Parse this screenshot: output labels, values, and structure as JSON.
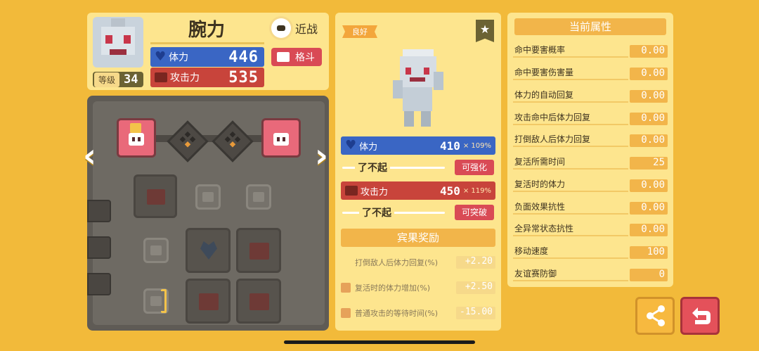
{
  "header": {
    "pokemon_name": "腕力",
    "level_label": "等级",
    "level": "34",
    "hp_label": "体力",
    "hp_value": "446",
    "atk_label": "攻击力",
    "atk_value": "535",
    "range_label": "近战",
    "type_label": "格斗"
  },
  "middle": {
    "quality_ribbon": "良好",
    "hp_label": "体力",
    "hp_value": "410",
    "hp_mult": "× 109%",
    "hp_grade": "了不起",
    "hp_action": "可强化",
    "atk_label": "攻击力",
    "atk_value": "450",
    "atk_mult": "× 119%",
    "atk_grade": "了不起",
    "atk_action": "可突破",
    "bingo_title": "宾果奖励",
    "bonuses": [
      {
        "label": "打倒敌人后体力回复(%)",
        "value": "+2.20"
      },
      {
        "label": "复活时的体力增加(%)",
        "value": "+2.50"
      },
      {
        "label": "普通攻击的等待时间(%)",
        "value": "-15.00"
      }
    ]
  },
  "attributes": {
    "title": "当前属性",
    "items": [
      {
        "label": "命中要害概率",
        "value": "0.00"
      },
      {
        "label": "命中要害伤害量",
        "value": "0.00"
      },
      {
        "label": "体力的自动回复",
        "value": "0.00"
      },
      {
        "label": "攻击命中后体力回复",
        "value": "0.00"
      },
      {
        "label": "打倒敌人后体力回复",
        "value": "0.00"
      },
      {
        "label": "复活所需时间",
        "value": "25"
      },
      {
        "label": "复活时的体力",
        "value": "0.00"
      },
      {
        "label": "负面效果抗性",
        "value": "0.00"
      },
      {
        "label": "全异常状态抗性",
        "value": "0.00"
      },
      {
        "label": "移动速度",
        "value": "100"
      },
      {
        "label": "友谊赛防御",
        "value": "0"
      }
    ]
  },
  "colors": {
    "background": "#f2ba3a",
    "panel": "#fde58e",
    "hp_blue": "#3a66c4",
    "atk_red": "#c8443b",
    "accent_orange": "#f2b54a"
  },
  "icons": {
    "hp": "heart-icon",
    "atk": "fist-icon",
    "share": "share-icon",
    "back": "return-icon",
    "favorite": "star-icon"
  }
}
